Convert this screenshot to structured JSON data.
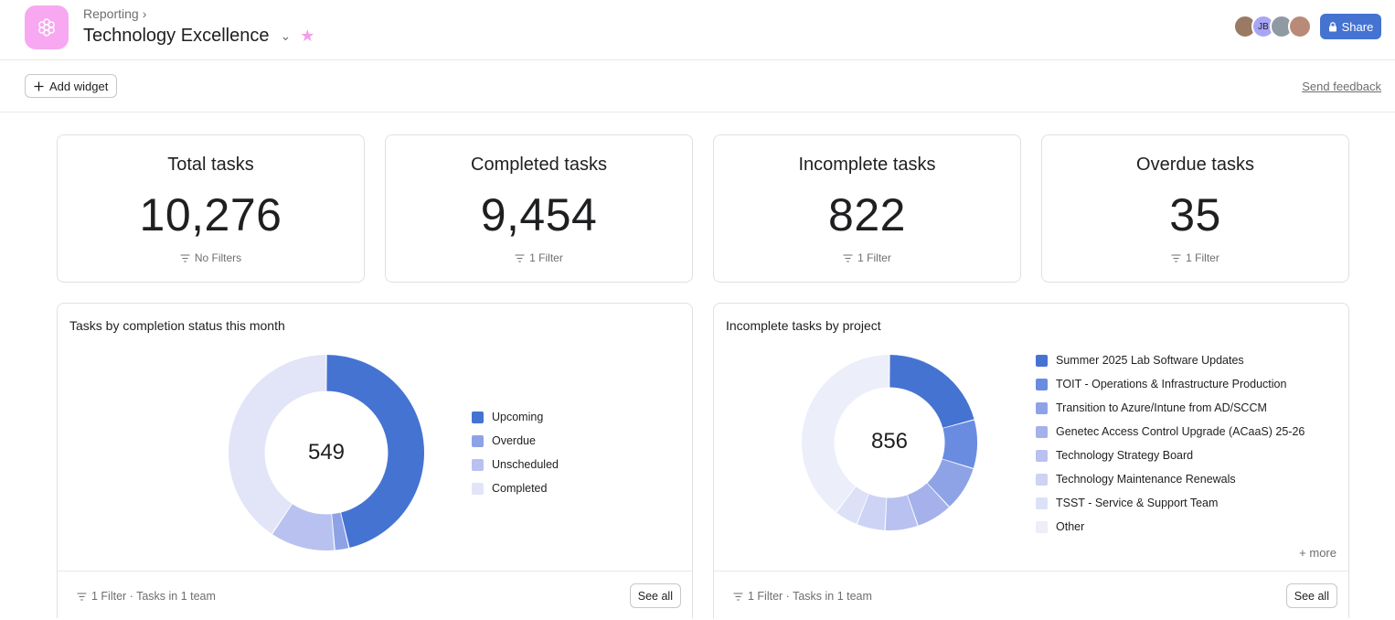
{
  "header": {
    "breadcrumb": "Reporting",
    "breadcrumb_chevron": "›",
    "title": "Technology Excellence",
    "title_chevron": "⌄",
    "star": "★",
    "app_icon": "asterisk-flower-icon",
    "avatars": [
      {
        "initials": "",
        "color": "#9a7a63",
        "kind": "photo"
      },
      {
        "initials": "JB",
        "color": "#a9a5f5",
        "kind": "initials"
      },
      {
        "initials": "",
        "color": "#8f9aa3",
        "kind": "photo"
      },
      {
        "initials": "",
        "color": "#b98a78",
        "kind": "photo"
      }
    ],
    "share_label": "Share",
    "accent_color": "#4573d2"
  },
  "toolbar": {
    "add_widget_label": "Add widget",
    "send_feedback_label": "Send feedback"
  },
  "stats": [
    {
      "title": "Total tasks",
      "value": "10,276",
      "filter": "No Filters"
    },
    {
      "title": "Completed tasks",
      "value": "9,454",
      "filter": "1 Filter"
    },
    {
      "title": "Incomplete tasks",
      "value": "822",
      "filter": "1 Filter"
    },
    {
      "title": "Overdue tasks",
      "value": "35",
      "filter": "1 Filter"
    }
  ],
  "charts": {
    "completion": {
      "title": "Tasks by completion status this month",
      "center": "549",
      "footer_filter": "1 Filter · Tasks in 1 team",
      "see_all": "See all"
    },
    "projects": {
      "title": "Incomplete tasks by project",
      "center": "856",
      "footer_filter": "1 Filter · Tasks in 1 team",
      "see_all": "See all",
      "more": "+ more"
    }
  },
  "chart_data": [
    {
      "type": "pie",
      "title": "Tasks by completion status this month",
      "total": 549,
      "categories": [
        "Upcoming",
        "Overdue",
        "Unscheduled",
        "Completed"
      ],
      "values": [
        254,
        13,
        59,
        223
      ],
      "colors": [
        "#4573d2",
        "#8ea3e6",
        "#b9c1f0",
        "#e2e5f7"
      ],
      "legend": "right"
    },
    {
      "type": "pie",
      "title": "Incomplete tasks by project",
      "total": 856,
      "categories": [
        "Summer 2025 Lab Software Updates",
        "TOIT - Operations & Infrastructure Production",
        "Transition to Azure/Intune from AD/SCCM",
        "Genetec Access Control Upgrade (ACaaS) 25-26",
        "Technology Strategy Board",
        "Technology Maintenance Renewals",
        "TSST - Service & Support Team",
        "Other"
      ],
      "values": [
        178,
        77,
        71,
        57,
        52,
        45,
        37,
        339
      ],
      "colors": [
        "#4573d2",
        "#6a8ce0",
        "#8ea3e6",
        "#a4b1ea",
        "#b9c1f0",
        "#cdd3f4",
        "#dde1f7",
        "#eceef9"
      ],
      "legend": "right"
    }
  ]
}
